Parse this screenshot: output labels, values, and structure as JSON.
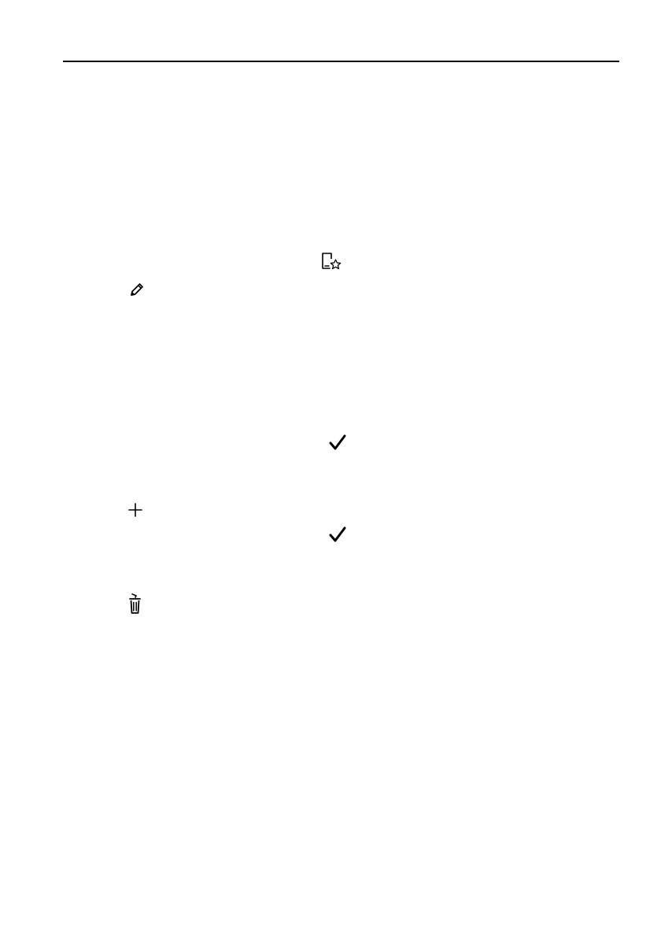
{
  "page": {
    "header_rule": true,
    "icons": [
      {
        "id": "favorite",
        "name": "add-to-favorites-icon"
      },
      {
        "id": "edit",
        "name": "pencil-edit-icon"
      },
      {
        "id": "check_1",
        "name": "checkmark-icon"
      },
      {
        "id": "add",
        "name": "plus-icon"
      },
      {
        "id": "check_2",
        "name": "checkmark-icon"
      },
      {
        "id": "delete",
        "name": "trash-can-icon"
      }
    ]
  }
}
